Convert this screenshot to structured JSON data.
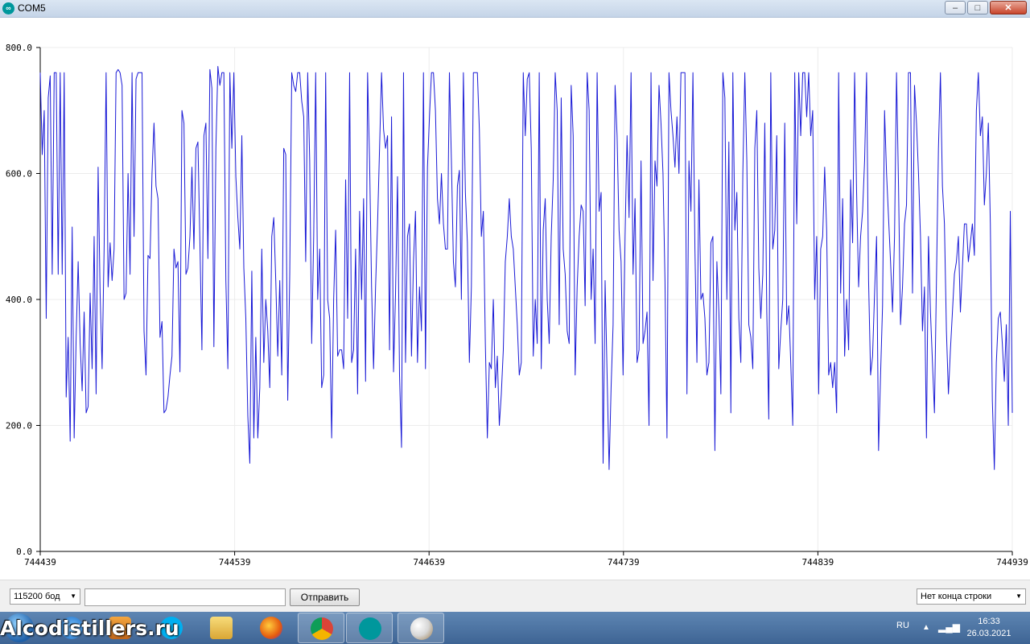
{
  "window": {
    "title": "COM5",
    "minimize": "–",
    "maximize": "□",
    "close": "✕"
  },
  "chart_data": {
    "type": "line",
    "ylim": [
      0,
      800
    ],
    "yticks": [
      "0.0",
      "200.0",
      "400.0",
      "600.0",
      "800.0"
    ],
    "x_range": [
      744439,
      744939
    ],
    "xticks": [
      "744439",
      "744539",
      "744639",
      "744739",
      "744839",
      "744939"
    ],
    "grid": true,
    "series": [
      {
        "color": "#1a1ad6",
        "values": [
          760,
          630,
          700,
          370,
          720,
          755,
          440,
          760,
          760,
          440,
          760,
          440,
          760,
          245,
          340,
          175,
          515,
          180,
          340,
          460,
          330,
          255,
          380,
          220,
          230,
          410,
          290,
          500,
          250,
          610,
          410,
          290,
          480,
          760,
          420,
          490,
          430,
          480,
          760,
          765,
          760,
          740,
          400,
          410,
          600,
          440,
          760,
          500,
          750,
          760,
          760,
          760,
          350,
          280,
          470,
          465,
          600,
          680,
          580,
          560,
          340,
          365,
          220,
          225,
          245,
          280,
          310,
          480,
          450,
          460,
          285,
          700,
          680,
          440,
          450,
          500,
          610,
          480,
          640,
          650,
          490,
          320,
          660,
          680,
          465,
          765,
          735,
          325,
          640,
          770,
          740,
          760,
          760,
          430,
          290,
          760,
          640,
          760,
          595,
          530,
          480,
          660,
          450,
          370,
          215,
          140,
          445,
          180,
          340,
          180,
          260,
          480,
          300,
          400,
          350,
          260,
          500,
          530,
          430,
          310,
          430,
          280,
          640,
          630,
          240,
          440,
          760,
          740,
          730,
          760,
          760,
          715,
          690,
          460,
          760,
          620,
          330,
          500,
          760,
          400,
          480,
          260,
          280,
          760,
          400,
          370,
          180,
          400,
          510,
          310,
          320,
          320,
          290,
          590,
          370,
          760,
          300,
          320,
          480,
          250,
          540,
          400,
          560,
          270,
          760,
          620,
          420,
          290,
          420,
          520,
          640,
          760,
          670,
          640,
          660,
          320,
          690,
          285,
          410,
          595,
          280,
          165,
          760,
          300,
          500,
          520,
          310,
          460,
          540,
          300,
          420,
          350,
          760,
          290,
          610,
          690,
          760,
          760,
          700,
          560,
          520,
          600,
          520,
          480,
          480,
          760,
          620,
          460,
          420,
          580,
          605,
          400,
          760,
          570,
          490,
          300,
          420,
          760,
          760,
          760,
          670,
          500,
          540,
          330,
          180,
          300,
          290,
          400,
          260,
          310,
          200,
          250,
          320,
          460,
          500,
          560,
          500,
          480,
          420,
          360,
          280,
          300,
          760,
          660,
          750,
          760,
          640,
          310,
          400,
          330,
          760,
          290,
          510,
          560,
          400,
          330,
          500,
          590,
          760,
          700,
          360,
          720,
          480,
          440,
          350,
          330,
          740,
          660,
          280,
          420,
          500,
          550,
          540,
          390,
          760,
          700,
          400,
          480,
          330,
          760,
          540,
          570,
          140,
          430,
          280,
          130,
          260,
          360,
          740,
          660,
          510,
          460,
          280,
          500,
          660,
          530,
          760,
          440,
          560,
          300,
          320,
          620,
          330,
          350,
          380,
          200,
          760,
          430,
          620,
          580,
          740,
          680,
          600,
          430,
          180,
          760,
          700,
          660,
          610,
          690,
          600,
          760,
          760,
          760,
          250,
          620,
          540,
          760,
          480,
          300,
          590,
          400,
          410,
          370,
          280,
          300,
          490,
          500,
          160,
          460,
          380,
          250,
          760,
          720,
          400,
          650,
          220,
          760,
          510,
          570,
          370,
          300,
          600,
          760,
          620,
          360,
          340,
          290,
          640,
          700,
          450,
          370,
          440,
          680,
          380,
          210,
          760,
          480,
          510,
          660,
          290,
          350,
          400,
          680,
          360,
          390,
          300,
          200,
          760,
          520,
          760,
          660,
          760,
          760,
          690,
          760,
          660,
          700,
          400,
          500,
          250,
          480,
          500,
          610,
          510,
          280,
          300,
          260,
          300,
          220,
          760,
          410,
          560,
          310,
          400,
          320,
          590,
          490,
          760,
          570,
          420,
          500,
          540,
          620,
          760,
          430,
          280,
          310,
          410,
          500,
          160,
          280,
          390,
          700,
          600,
          530,
          460,
          380,
          500,
          760,
          580,
          360,
          420,
          520,
          550,
          760,
          760,
          410,
          740,
          680,
          600,
          500,
          350,
          420,
          180,
          500,
          380,
          300,
          220,
          430,
          640,
          760,
          580,
          520,
          350,
          250,
          320,
          380,
          440,
          460,
          500,
          380,
          450,
          520,
          520,
          460,
          490,
          520,
          470,
          700,
          760,
          660,
          690,
          550,
          600,
          680,
          520,
          240,
          130,
          300,
          370,
          380,
          330,
          270,
          360,
          200,
          540,
          220
        ]
      }
    ]
  },
  "bottom": {
    "baud": "115200 бод",
    "send_label": "Отправить",
    "line_ending": "Нет конца строки",
    "input_value": ""
  },
  "taskbar": {
    "watermark": "Alcodistillers.ru",
    "language": "RU",
    "time": "16:33",
    "date": "26.03.2021"
  }
}
